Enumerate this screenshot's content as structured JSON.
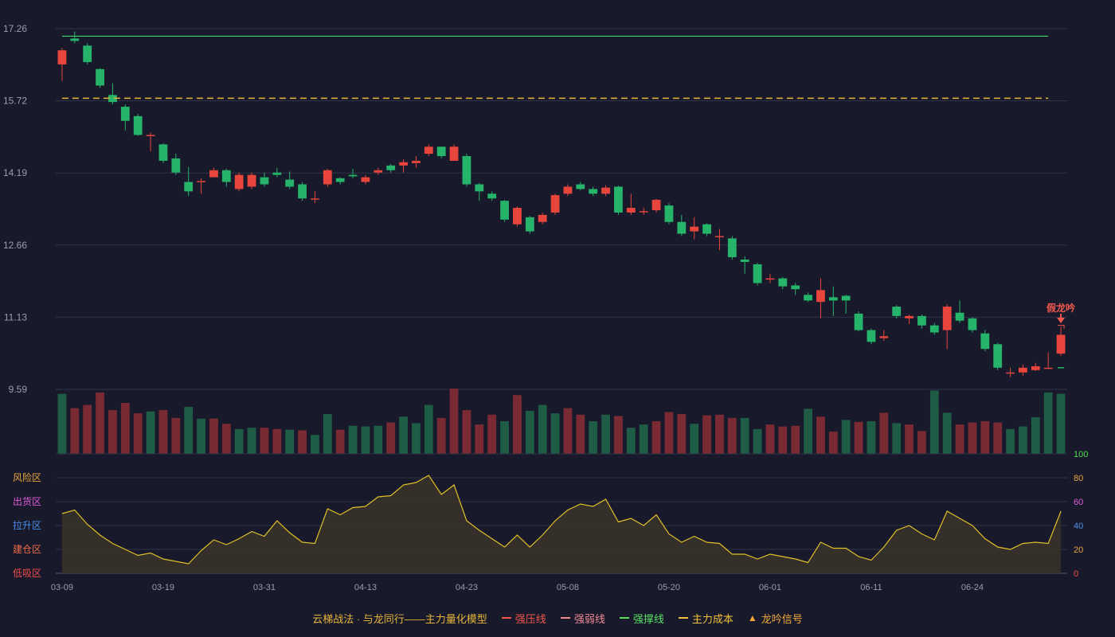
{
  "chart_data": {
    "type": "candlestick",
    "x_ticks": [
      "03-09",
      "03-19",
      "03-31",
      "04-13",
      "04-23",
      "05-08",
      "05-20",
      "06-01",
      "06-11",
      "06-24"
    ],
    "y_ticks": [
      "17.26",
      "15.72",
      "14.19",
      "12.66",
      "11.13",
      "9.59"
    ],
    "ylim": [
      9.59,
      17.26
    ],
    "candles": [
      [
        16.5,
        16.8,
        16.85,
        16.15
      ],
      [
        17.05,
        17.0,
        17.2,
        16.95
      ],
      [
        16.9,
        16.55,
        16.95,
        16.5
      ],
      [
        16.4,
        16.05,
        16.42,
        16.0
      ],
      [
        15.85,
        15.7,
        16.1,
        15.65
      ],
      [
        15.6,
        15.3,
        15.65,
        15.1
      ],
      [
        15.4,
        15.0,
        15.45,
        14.98
      ],
      [
        14.99,
        15.0,
        15.05,
        14.65
      ],
      [
        14.8,
        14.45,
        14.82,
        14.4
      ],
      [
        14.5,
        14.2,
        14.6,
        14.15
      ],
      [
        14.0,
        13.8,
        14.32,
        13.7
      ],
      [
        14.0,
        14.02,
        14.08,
        13.75
      ],
      [
        14.1,
        14.25,
        14.3,
        14.1
      ],
      [
        14.25,
        14.0,
        14.28,
        13.9
      ],
      [
        13.85,
        14.15,
        14.2,
        13.8
      ],
      [
        13.9,
        14.15,
        14.2,
        13.85
      ],
      [
        14.1,
        13.95,
        14.2,
        13.9
      ],
      [
        14.2,
        14.15,
        14.3,
        14.1
      ],
      [
        14.05,
        13.9,
        14.22,
        13.85
      ],
      [
        13.95,
        13.65,
        14.0,
        13.6
      ],
      [
        13.65,
        13.65,
        13.8,
        13.55
      ],
      [
        13.95,
        14.25,
        14.28,
        13.9
      ],
      [
        14.08,
        14.0,
        14.1,
        13.95
      ],
      [
        14.15,
        14.12,
        14.28,
        14.08
      ],
      [
        14.0,
        14.1,
        14.15,
        13.95
      ],
      [
        14.2,
        14.25,
        14.3,
        14.15
      ],
      [
        14.35,
        14.25,
        14.38,
        14.2
      ],
      [
        14.35,
        14.42,
        14.48,
        14.2
      ],
      [
        14.4,
        14.45,
        14.55,
        14.3
      ],
      [
        14.6,
        14.75,
        14.8,
        14.55
      ],
      [
        14.75,
        14.55,
        14.75,
        14.5
      ],
      [
        14.45,
        14.75,
        14.8,
        14.45
      ],
      [
        14.55,
        13.95,
        14.6,
        13.9
      ],
      [
        13.95,
        13.8,
        13.98,
        13.6
      ],
      [
        13.75,
        13.65,
        13.8,
        13.6
      ],
      [
        13.6,
        13.2,
        13.62,
        13.15
      ],
      [
        13.1,
        13.45,
        13.48,
        13.05
      ],
      [
        13.25,
        12.95,
        13.28,
        12.9
      ],
      [
        13.15,
        13.3,
        13.35,
        13.1
      ],
      [
        13.35,
        13.72,
        13.75,
        13.3
      ],
      [
        13.75,
        13.9,
        13.95,
        13.7
      ],
      [
        13.95,
        13.85,
        14.0,
        13.82
      ],
      [
        13.85,
        13.75,
        13.9,
        13.7
      ],
      [
        13.75,
        13.88,
        13.93,
        13.7
      ],
      [
        13.9,
        13.35,
        13.92,
        13.3
      ],
      [
        13.35,
        13.45,
        13.75,
        13.3
      ],
      [
        13.38,
        13.38,
        13.45,
        13.3
      ],
      [
        13.4,
        13.62,
        13.64,
        13.35
      ],
      [
        13.5,
        13.15,
        13.55,
        13.1
      ],
      [
        13.15,
        12.9,
        13.3,
        12.85
      ],
      [
        12.95,
        13.05,
        13.25,
        12.78
      ],
      [
        13.1,
        12.9,
        13.12,
        12.85
      ],
      [
        12.85,
        12.85,
        13.0,
        12.55
      ],
      [
        12.8,
        12.4,
        12.85,
        12.35
      ],
      [
        12.35,
        12.3,
        12.42,
        12.05
      ],
      [
        12.25,
        11.85,
        12.28,
        11.8
      ],
      [
        11.95,
        11.95,
        12.05,
        11.85
      ],
      [
        11.95,
        11.78,
        11.98,
        11.72
      ],
      [
        11.8,
        11.72,
        11.85,
        11.6
      ],
      [
        11.6,
        11.48,
        11.65,
        11.45
      ],
      [
        11.45,
        11.7,
        11.95,
        11.1
      ],
      [
        11.55,
        11.48,
        11.78,
        11.15
      ],
      [
        11.58,
        11.48,
        11.6,
        11.2
      ],
      [
        11.2,
        10.85,
        11.25,
        10.82
      ],
      [
        10.85,
        10.6,
        10.88,
        10.55
      ],
      [
        10.68,
        10.72,
        10.85,
        10.62
      ],
      [
        11.35,
        11.15,
        11.38,
        11.1
      ],
      [
        11.1,
        11.15,
        11.18,
        10.98
      ],
      [
        11.15,
        10.95,
        11.18,
        10.88
      ],
      [
        10.95,
        10.8,
        11.0,
        10.75
      ],
      [
        10.85,
        11.35,
        11.4,
        10.45
      ],
      [
        11.22,
        11.05,
        11.48,
        11.0
      ],
      [
        11.1,
        10.85,
        11.12,
        10.8
      ],
      [
        10.78,
        10.45,
        10.85,
        10.4
      ],
      [
        10.55,
        10.05,
        10.58,
        10.0
      ],
      [
        9.95,
        9.95,
        10.05,
        9.85
      ],
      [
        9.95,
        10.05,
        10.12,
        9.88
      ],
      [
        10.0,
        10.08,
        10.15,
        9.98
      ],
      [
        10.05,
        10.05,
        10.38,
        10.05
      ],
      [
        10.35,
        10.75,
        10.92,
        10.3
      ]
    ],
    "volumes": [
      92,
      70,
      75,
      94,
      67,
      78,
      62,
      65,
      67,
      55,
      72,
      54,
      54,
      46,
      38,
      40,
      40,
      38,
      37,
      36,
      29,
      61,
      37,
      43,
      42,
      43,
      48,
      57,
      47,
      75,
      55,
      100,
      67,
      45,
      60,
      50,
      90,
      66,
      75,
      62,
      70,
      60,
      50,
      60,
      58,
      40,
      45,
      50,
      64,
      61,
      46,
      59,
      60,
      55,
      55,
      38,
      45,
      42,
      43,
      69,
      57,
      34,
      52,
      49,
      50,
      63,
      47,
      45,
      35,
      97,
      63,
      45,
      48,
      50,
      48,
      38,
      42,
      56,
      94,
      92
    ],
    "volume_dir": [
      -1,
      1,
      1,
      1,
      1,
      1,
      1,
      -1,
      1,
      1,
      -1,
      -1,
      1,
      1,
      -1,
      -1,
      1,
      1,
      -1,
      1,
      -1,
      -1,
      1,
      -1,
      -1,
      -1,
      1,
      -1,
      -1,
      -1,
      1,
      1,
      1,
      1,
      1,
      -1,
      1,
      -1,
      -1,
      -1,
      1,
      1,
      -1,
      -1,
      1,
      -1,
      -1,
      1,
      1,
      1,
      -1,
      1,
      1,
      1,
      -1,
      -1,
      1,
      1,
      1,
      -1,
      1,
      1,
      -1,
      1,
      -1,
      1,
      -1,
      1,
      1,
      -1,
      -1,
      1,
      1,
      1,
      1,
      -1,
      -1,
      -1,
      -1,
      -1
    ],
    "score": [
      50,
      53,
      41,
      32,
      25,
      20,
      15,
      17,
      12,
      10,
      8,
      19,
      28,
      24,
      29,
      35,
      31,
      44,
      34,
      26,
      25,
      54,
      49,
      55,
      56,
      64,
      65,
      74,
      76,
      82,
      66,
      74,
      44,
      36,
      29,
      22,
      32,
      22,
      32,
      44,
      53,
      58,
      56,
      62,
      43,
      46,
      40,
      49,
      33,
      26,
      31,
      26,
      25,
      16,
      16,
      12,
      16,
      14,
      12,
      9,
      26,
      21,
      21,
      14,
      11,
      22,
      36,
      40,
      33,
      28,
      52,
      46,
      40,
      29,
      22,
      20,
      25,
      26,
      25,
      52
    ],
    "resistance_line": 17.1,
    "cost_line": 15.78,
    "signal": {
      "label": "假龙吟",
      "index": 79
    },
    "score_ticks": [
      "100",
      "80",
      "60",
      "40",
      "20",
      "0"
    ],
    "zone_labels": [
      "风险区",
      "出货区",
      "拉升区",
      "建仓区",
      "低吸区"
    ],
    "colors": {
      "up": "#e8453c",
      "down": "#26b36a",
      "up_vol": "#7a2a32",
      "down_vol": "#1f5c46",
      "score_line": "#e0c028",
      "resist": "#45d269",
      "cost": "#e6b43a",
      "signal": "#f0584e"
    }
  },
  "legend": {
    "title": "云梯战法 · 与龙同行——主力量化模型",
    "items": [
      {
        "label": "强压线",
        "color": "#f2564b",
        "style": "solid"
      },
      {
        "label": "强弱线",
        "color": "#f28a96",
        "style": "dashed"
      },
      {
        "label": "强撑线",
        "color": "#58e066",
        "style": "solid"
      },
      {
        "label": "主力成本",
        "color": "#f2c13a",
        "style": "dashed"
      },
      {
        "label": "龙吟信号",
        "color": "#f2a93a",
        "style": "triangle"
      }
    ]
  }
}
